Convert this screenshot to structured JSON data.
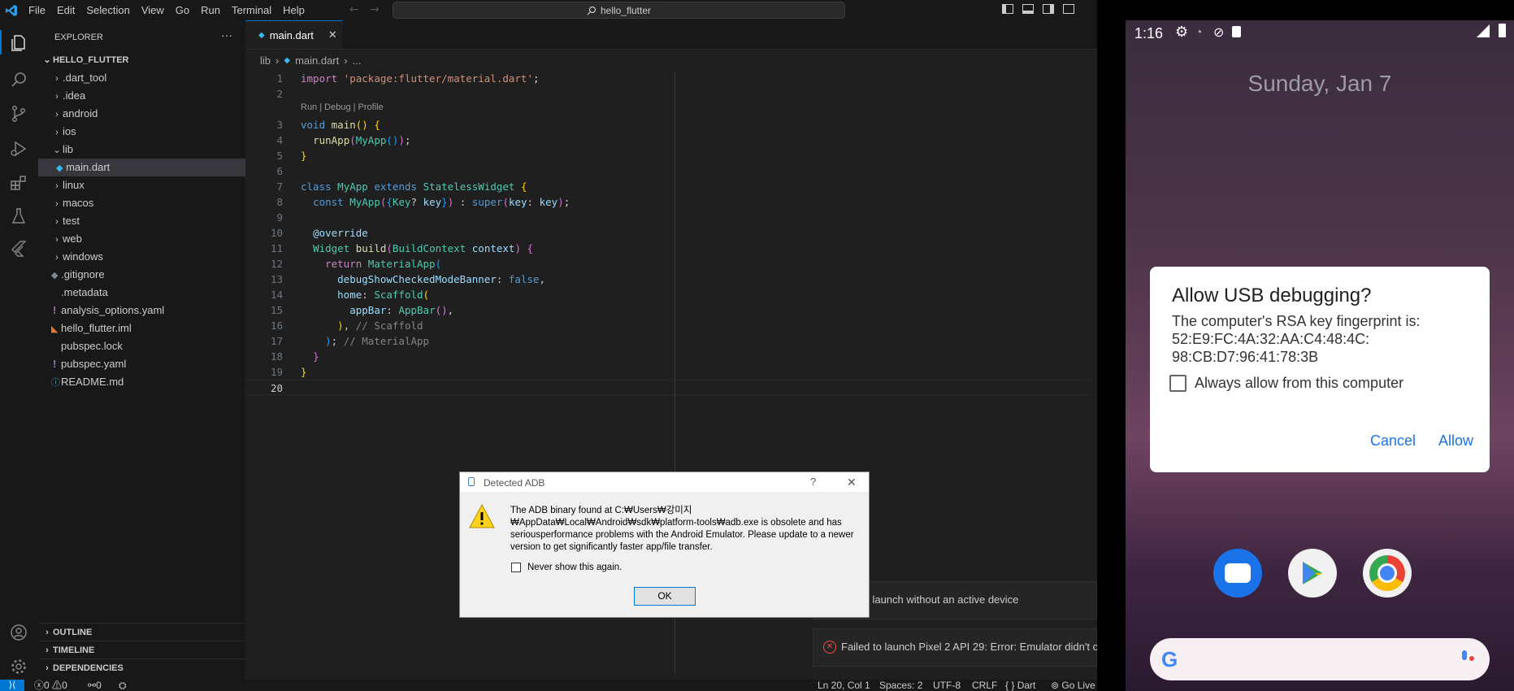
{
  "menu": {
    "items": [
      "File",
      "Edit",
      "Selection",
      "View",
      "Go",
      "Run",
      "Terminal",
      "Help"
    ],
    "search_text": "hello_flutter"
  },
  "explorer": {
    "title": "EXPLORER",
    "more": "···",
    "root": "HELLO_FLUTTER",
    "items": [
      {
        "label": ".dart_tool",
        "type": "folder"
      },
      {
        "label": ".idea",
        "type": "folder"
      },
      {
        "label": "android",
        "type": "folder"
      },
      {
        "label": "ios",
        "type": "folder"
      },
      {
        "label": "lib",
        "type": "folder-open"
      },
      {
        "label": "main.dart",
        "type": "dart"
      },
      {
        "label": "linux",
        "type": "folder"
      },
      {
        "label": "macos",
        "type": "folder"
      },
      {
        "label": "test",
        "type": "folder"
      },
      {
        "label": "web",
        "type": "folder"
      },
      {
        "label": "windows",
        "type": "folder"
      },
      {
        "label": ".gitignore",
        "type": "git"
      },
      {
        "label": ".metadata",
        "type": "file"
      },
      {
        "label": "analysis_options.yaml",
        "type": "yaml"
      },
      {
        "label": "hello_flutter.iml",
        "type": "rss"
      },
      {
        "label": "pubspec.lock",
        "type": "file"
      },
      {
        "label": "pubspec.yaml",
        "type": "yaml"
      },
      {
        "label": "README.md",
        "type": "info"
      }
    ],
    "sections": [
      "OUTLINE",
      "TIMELINE",
      "DEPENDENCIES"
    ]
  },
  "editor": {
    "tab_label": "main.dart",
    "breadcrumb": [
      "lib",
      "main.dart",
      "..."
    ],
    "codelens": "Run | Debug | Profile",
    "line_numbers": [
      "1",
      "2",
      "3",
      "4",
      "5",
      "6",
      "7",
      "8",
      "9",
      "10",
      "11",
      "12",
      "13",
      "14",
      "15",
      "16",
      "17",
      "18",
      "19",
      "20"
    ]
  },
  "adb_dialog": {
    "title": "Detected ADB",
    "help": "?",
    "close": "✕",
    "message": "The ADB binary found at C:₩Users₩강미지₩AppData₩Local₩Android₩sdk₩platform-tools₩adb.exe is obsolete and has seriousperformance problems with the Android Emulator. Please update to a newer version to get significantly faster app/file transfer.",
    "checkbox_label": "Never show this again.",
    "ok_label": "OK"
  },
  "notifications": {
    "first": "ot launch without an active device",
    "second": "Failed to launch Pixel 2 API 29: Error: Emulator didn't co"
  },
  "statusbar": {
    "errors": "0",
    "warnings": "0",
    "ports": "0",
    "position": "Ln 20, Col 1",
    "spaces": "Spaces: 2",
    "encoding": "UTF-8",
    "eol": "CRLF",
    "language": "Dart",
    "golive": "Go Live"
  },
  "phone": {
    "time": "1:16",
    "date": "Sunday, Jan 7",
    "dialog": {
      "title": "Allow USB debugging?",
      "body": "The computer's RSA key fingerprint is:",
      "fingerprint_1": "52:E9:FC:4A:32:AA:C4:48:4C:",
      "fingerprint_2": "98:CB:D7:96:41:78:3B",
      "checkbox_label": "Always allow from this computer",
      "cancel_label": "Cancel",
      "allow_label": "Allow"
    },
    "accent": "#1a73e8"
  }
}
